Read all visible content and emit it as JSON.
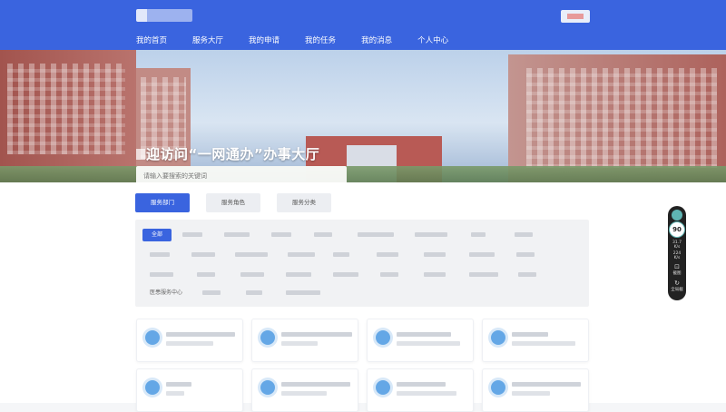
{
  "nav": [
    {
      "label": "我的首页",
      "active": false
    },
    {
      "label": "服务大厅",
      "active": true
    },
    {
      "label": "我的申请",
      "active": false
    },
    {
      "label": "我的任务",
      "active": false
    },
    {
      "label": "我的消息",
      "active": false
    },
    {
      "label": "个人中心",
      "active": false
    }
  ],
  "hero": {
    "title": "迎访问“一网通办”办事大厅",
    "search_placeholder": "请输入要搜索的关键词"
  },
  "tabs": {
    "dept": "服务部门",
    "role": "服务角色",
    "category": "服务分类"
  },
  "filter": {
    "all": "全部",
    "last_chip": "医患服务中心"
  },
  "side_widget": {
    "score": "90",
    "stat1_value": "31.7",
    "stat1_unit": "K/s",
    "stat2_value": "224",
    "stat2_unit": "K/s",
    "screenshot_label": "截图",
    "refresh_label": "全局截"
  },
  "colors": {
    "brand": "#3a64df",
    "active_underline": "#ffd24a",
    "card_icon": "#64a7e6"
  }
}
